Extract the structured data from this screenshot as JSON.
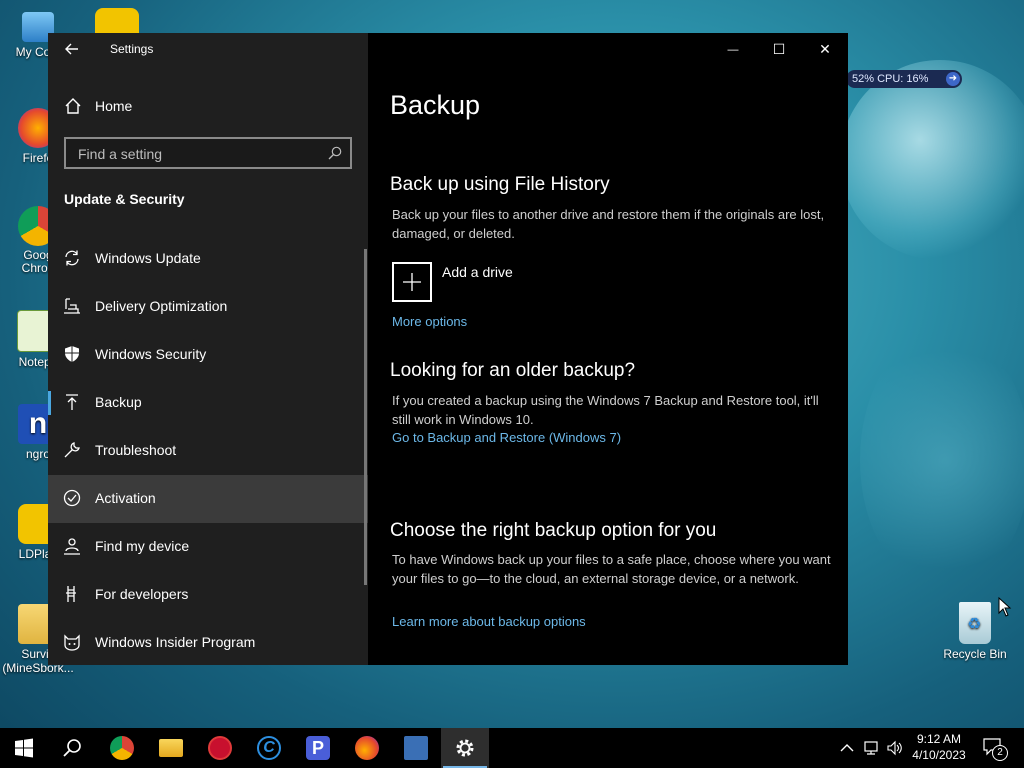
{
  "desktop": {
    "icons": [
      {
        "label": "My Com"
      },
      {
        "label": "Firefo"
      },
      {
        "label": "Goog\nChron"
      },
      {
        "label": "Notepa"
      },
      {
        "label": "ngro"
      },
      {
        "label": "LDPlay"
      },
      {
        "label": "Surviv\n(MineSbork..."
      }
    ],
    "recycle_bin": {
      "label": "Recycle Bin"
    },
    "cpu_widget": {
      "text": "52%  CPU: 16%"
    }
  },
  "window": {
    "title": "Settings",
    "controls": {
      "minimize": "—",
      "maximize": "☐",
      "close": "✕"
    }
  },
  "sidebar": {
    "home_label": "Home",
    "search": {
      "placeholder": "Find a setting",
      "value": ""
    },
    "section_title": "Update & Security",
    "items": [
      {
        "label": "Windows Update",
        "icon": "sync-icon"
      },
      {
        "label": "Delivery Optimization",
        "icon": "delivery-icon"
      },
      {
        "label": "Windows Security",
        "icon": "shield-icon"
      },
      {
        "label": "Backup",
        "icon": "backup-arrow-icon",
        "selected": true
      },
      {
        "label": "Troubleshoot",
        "icon": "wrench-icon"
      },
      {
        "label": "Activation",
        "icon": "check-circle-icon",
        "hover": true
      },
      {
        "label": "Find my device",
        "icon": "person-location-icon"
      },
      {
        "label": "For developers",
        "icon": "developer-icon"
      },
      {
        "label": "Windows Insider Program",
        "icon": "insider-cat-icon"
      }
    ]
  },
  "content": {
    "page_title": "Backup",
    "file_history": {
      "heading": "Back up using File History",
      "description": "Back up your files to another drive and restore them if the originals are lost, damaged, or deleted.",
      "add_drive_label": "Add a drive",
      "more_options": "More options"
    },
    "older_backup": {
      "heading": "Looking for an older backup?",
      "description": "If you created a backup using the Windows 7 Backup and Restore tool, it'll still work in Windows 10.",
      "link": "Go to Backup and Restore (Windows 7)"
    },
    "right_option": {
      "heading": "Choose the right backup option for you",
      "description": "To have Windows back up your files to a safe place, choose where you want your files to go—to the cloud, an external storage device, or a network.",
      "link": "Learn more about backup options"
    }
  },
  "taskbar": {
    "apps": [
      "start-icon",
      "search-icon",
      "chrome-icon",
      "file-explorer-icon",
      "red-app-icon",
      "ccleaner-icon",
      "p-app-icon",
      "firefox-icon",
      "calculator-icon",
      "settings-gear-icon"
    ],
    "clock": {
      "time": "9:12 AM",
      "date": "4/10/2023"
    },
    "notification_count": "2"
  },
  "colors": {
    "accent": "#4aa7e0",
    "link": "#6cb8e8",
    "sidebar_bg": "#1f1f1f",
    "content_bg": "#000000"
  }
}
